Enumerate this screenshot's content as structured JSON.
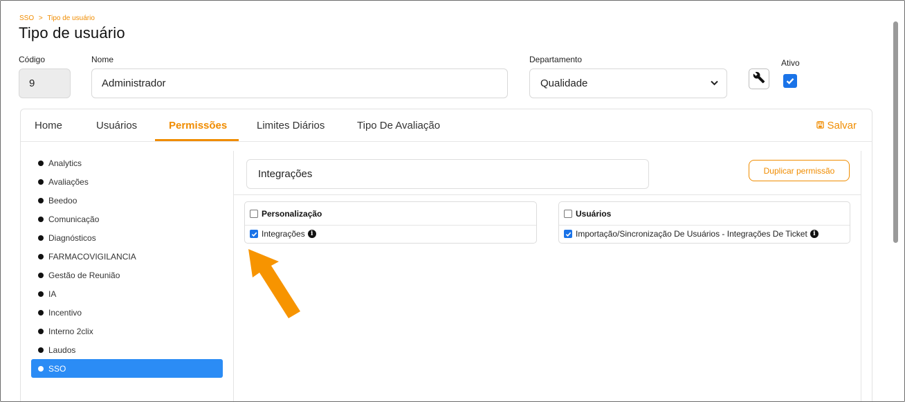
{
  "breadcrumb": {
    "root": "SSO",
    "separator": ">",
    "current": "Tipo de usuário"
  },
  "page_title": "Tipo de usuário",
  "form": {
    "codigo_label": "Código",
    "codigo_value": "9",
    "nome_label": "Nome",
    "nome_value": "Administrador",
    "departamento_label": "Departamento",
    "departamento_value": "Qualidade",
    "ativo_label": "Ativo",
    "ativo_checked": true
  },
  "tabs": [
    {
      "label": "Home",
      "active": false
    },
    {
      "label": "Usuários",
      "active": false
    },
    {
      "label": "Permissões",
      "active": true
    },
    {
      "label": "Limites Diários",
      "active": false
    },
    {
      "label": "Tipo De Avaliação",
      "active": false
    }
  ],
  "save_label": "Salvar",
  "sidebar": {
    "items": [
      {
        "label": "Analytics",
        "active": false
      },
      {
        "label": "Avaliações",
        "active": false
      },
      {
        "label": "Beedoo",
        "active": false
      },
      {
        "label": "Comunicação",
        "active": false
      },
      {
        "label": "Diagnósticos",
        "active": false
      },
      {
        "label": "FARMACOVIGILANCIA",
        "active": false
      },
      {
        "label": "Gestão de Reunião",
        "active": false
      },
      {
        "label": "IA",
        "active": false
      },
      {
        "label": "Incentivo",
        "active": false
      },
      {
        "label": "Interno 2clix",
        "active": false
      },
      {
        "label": "Laudos",
        "active": false
      },
      {
        "label": "SSO",
        "active": true
      }
    ]
  },
  "module_name": "Integrações",
  "duplicate_button": "Duplicar permissão",
  "groups": [
    {
      "title": "Personalização",
      "checked": false,
      "items": [
        {
          "label": "Integrações",
          "checked": true
        }
      ]
    },
    {
      "title": "Usuários",
      "checked": false,
      "items": [
        {
          "label": "Importação/Sincronização De Usuários - Integrações De Ticket",
          "checked": true
        }
      ]
    }
  ],
  "colors": {
    "accent": "#f08c00",
    "primary": "#1a73e8",
    "sidebar_active": "#2b8cf5"
  },
  "icons": {
    "wrench": "wrench-icon",
    "save": "save-icon",
    "info": "info-icon",
    "chevron": "chevron-down-icon"
  }
}
